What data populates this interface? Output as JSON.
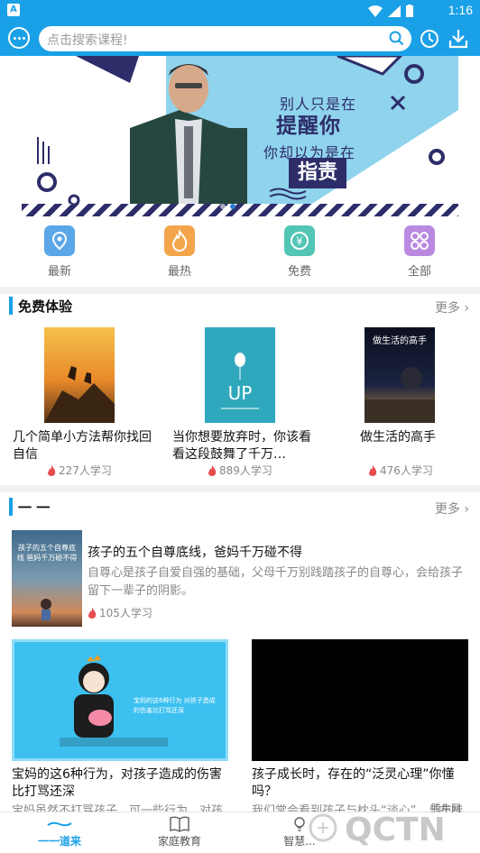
{
  "status_bar": {
    "time": "1:16",
    "app_badge": "A"
  },
  "header": {
    "search_placeholder": "点击搜索课程!"
  },
  "banner": {
    "line1": "别人只是在",
    "line2": "提醒你",
    "line3": "你却以为是在",
    "line4": "指责"
  },
  "categories": [
    {
      "label": "最新",
      "icon": "location-icon",
      "color": "#5aa7e8"
    },
    {
      "label": "最热",
      "icon": "flame-icon",
      "color": "#f3a54b"
    },
    {
      "label": "免费",
      "icon": "yen-icon",
      "color": "#52c5b5"
    },
    {
      "label": "全部",
      "icon": "grid-icon",
      "color": "#b98ae0"
    }
  ],
  "free_section": {
    "title": "免费体验",
    "more": "更多",
    "items": [
      {
        "title": "几个简单小方法帮你找回自信",
        "learners": "227人学习",
        "cover_text": ""
      },
      {
        "title": "当你想要放弃时，你该看看这段鼓舞了千万…",
        "learners": "889人学习",
        "cover_text": "UP"
      },
      {
        "title": "做生活的高手",
        "learners": "476人学习",
        "cover_text": "做生活的高手"
      }
    ]
  },
  "second_section": {
    "title": "一 一",
    "more": "更多",
    "list": [
      {
        "title": "孩子的五个自尊底线，爸妈千万碰不得",
        "desc": "自尊心是孩子自爱自强的基础，父母千万别践踏孩子的自尊心，会给孩子留下一辈子的阴影。",
        "learners": "105人学习",
        "thumb_text": "孩子的五个自尊底线 爸妈千万碰不得"
      }
    ],
    "cards": [
      {
        "title": "宝妈的这6种行为，对孩子造成的伤害比打骂还深",
        "desc": "宝妈虽然不打骂孩子，可一些行为，对孩",
        "thumb_text": "宝妈的这6种行为 对孩子造成的伤害比打骂还深"
      },
      {
        "title": "孩子成长时，存在的“泛灵心理”你懂吗？",
        "desc": "我们常会看到孩子与枕头“谈心”，与布娃",
        "thumb_text": ""
      }
    ]
  },
  "bottom_nav": [
    {
      "label": "一一道来",
      "active": true
    },
    {
      "label": "家庭教育",
      "active": false
    },
    {
      "label": "智慧...",
      "active": false
    }
  ],
  "watermark": {
    "text": "QCTN",
    "sub": "腾牛网"
  },
  "colors": {
    "primary": "#1aa0e6",
    "fire": "#e84d4d",
    "banner_navy": "#2d2d6a",
    "banner_sky": "#8fd3ec"
  }
}
